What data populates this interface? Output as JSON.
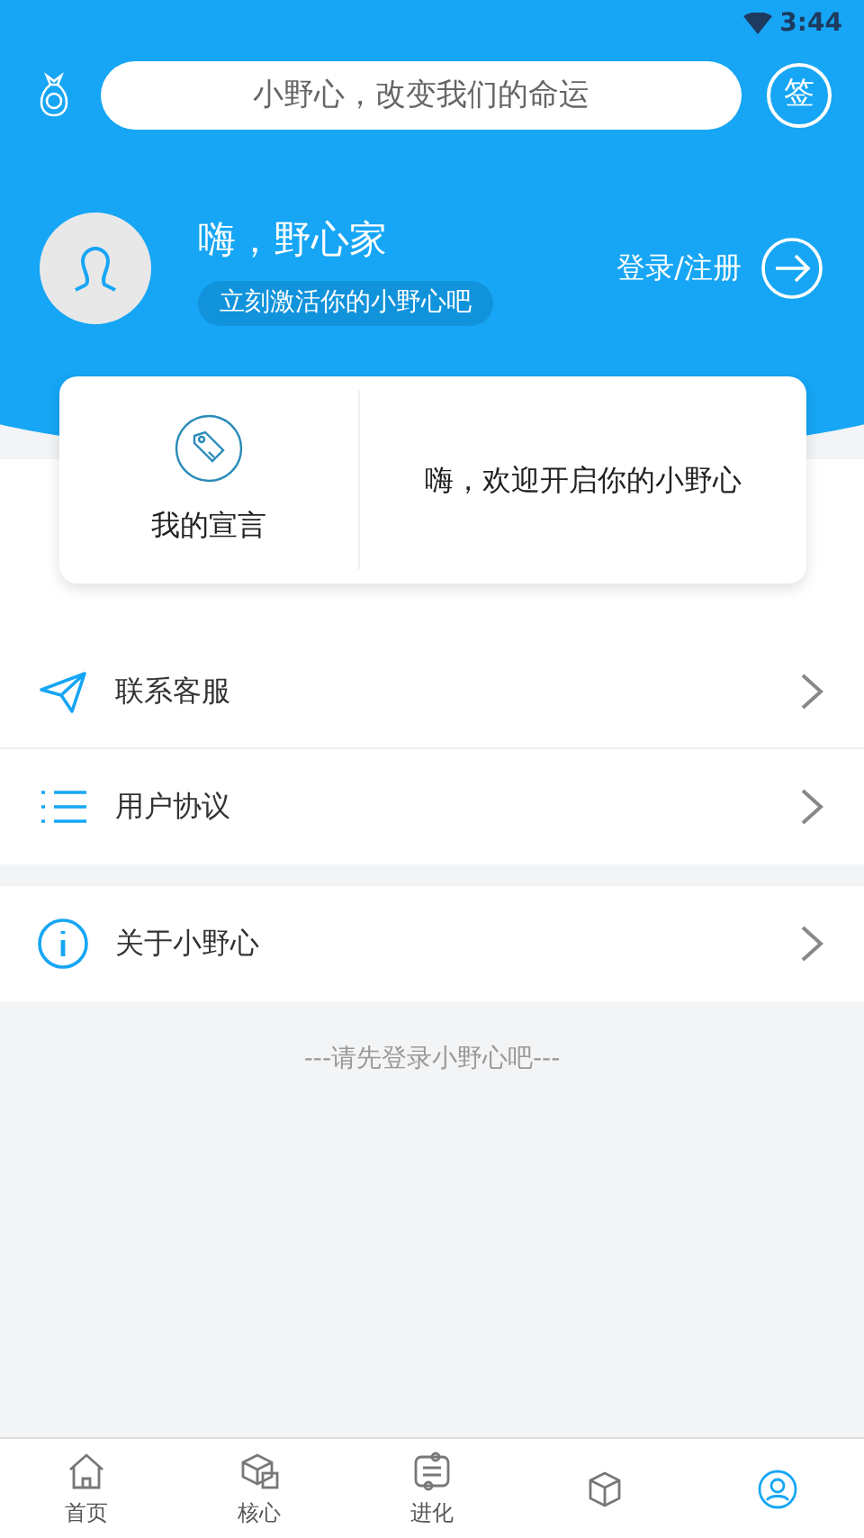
{
  "status_bar": {
    "time": "3:44"
  },
  "search": {
    "placeholder": "小野心，改变我们的命运"
  },
  "sign_button": {
    "label": "签"
  },
  "profile": {
    "greeting": "嗨，野心家",
    "subtitle": "立刻激活你的小野心吧",
    "login": "登录/注册"
  },
  "card": {
    "label": "我的宣言",
    "message": "嗨，欢迎开启你的小野心"
  },
  "menu_groups": [
    [
      {
        "label": "联系客服"
      },
      {
        "label": "用户协议"
      }
    ],
    [
      {
        "label": "关于小野心"
      }
    ]
  ],
  "footer_note": "---请先登录小野心吧---",
  "nav": [
    {
      "label": "首页",
      "selected": false
    },
    {
      "label": "核心",
      "selected": false
    },
    {
      "label": "进化",
      "selected": false
    },
    {
      "selected": false
    },
    {
      "selected": true
    }
  ]
}
